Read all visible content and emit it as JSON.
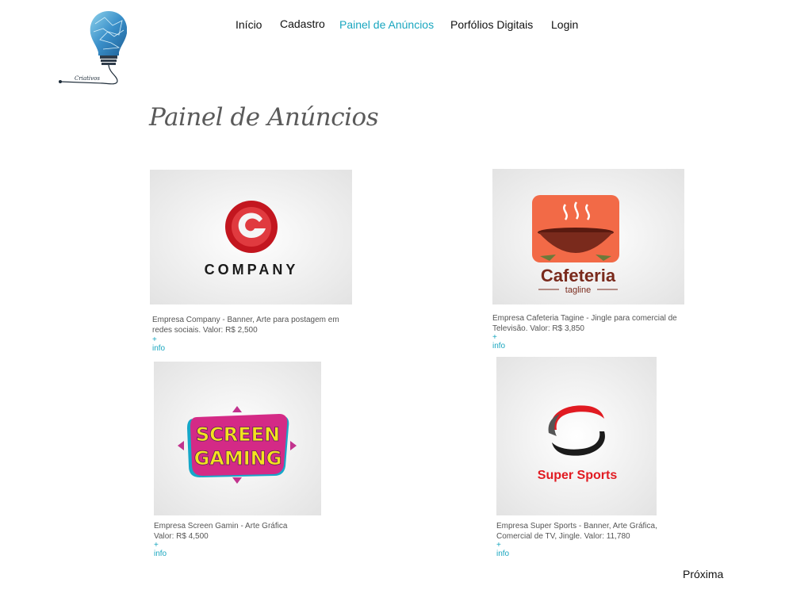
{
  "brand": {
    "logo_text": "Criativos"
  },
  "nav": {
    "items": [
      {
        "label": "Início"
      },
      {
        "label": "Cadastro"
      },
      {
        "label": "Painel de Anúncios",
        "active": true
      },
      {
        "label": "Porfólios Digitais"
      },
      {
        "label": "Login"
      }
    ],
    "active_color": "#19a6bf"
  },
  "page": {
    "title": "Painel de Anúncios"
  },
  "cards": [
    {
      "logo_text": "COMPANY",
      "description": "Empresa Company - Banner, Arte para postagem em redes sociais. Valor: R$ 2,500",
      "info_label": "+ info"
    },
    {
      "logo_text": "Cafeteria",
      "logo_subtext": "tagline",
      "description": "Empresa Cafeteria Tagine - Jingle para comercial de Televisão. Valor: R$ 3,850",
      "info_label": "+ info"
    },
    {
      "logo_text_line1": "SCREEN",
      "logo_text_line2": "GAMING",
      "description": "Empresa Screen Gamin - Arte Gráfica Valor: R$ 4,500",
      "info_label": "+ info"
    },
    {
      "logo_text": "Super Sports",
      "description": "Empresa Super Sports - Banner, Arte Gráfica, Comercial de TV, Jingle. Valor: 11,780",
      "info_label": "+ info"
    }
  ],
  "pagination": {
    "next_label": "Próxima"
  }
}
